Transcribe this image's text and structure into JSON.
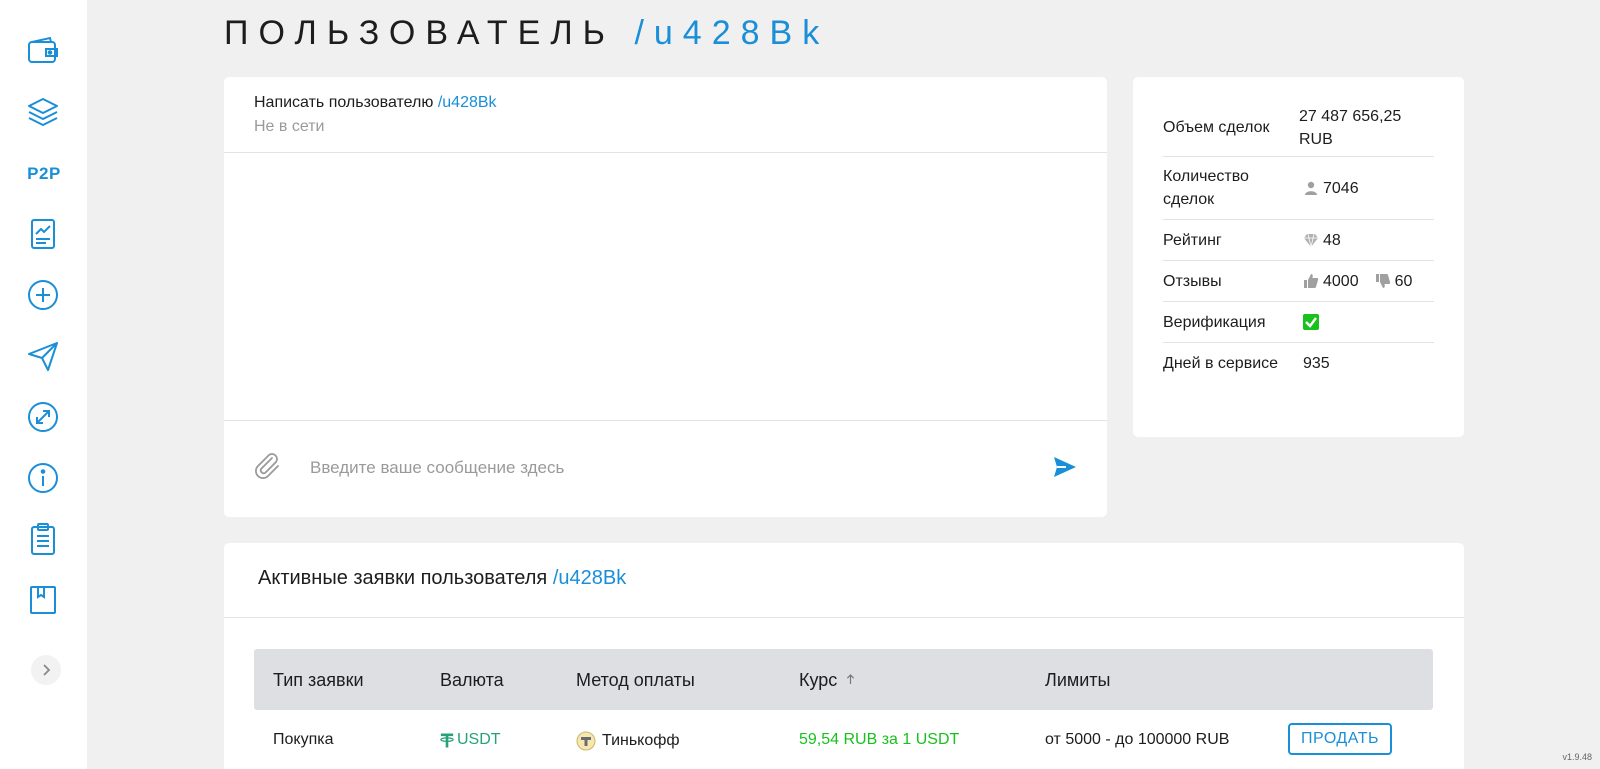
{
  "colors": {
    "accent": "#1a8fd8",
    "success": "#17c21d",
    "usdt": "#26a17b"
  },
  "sidebar": {
    "items": [
      {
        "name": "wallet-icon"
      },
      {
        "name": "layers-icon"
      },
      {
        "name": "p2p",
        "label": "P2P"
      },
      {
        "name": "report-chart-icon"
      },
      {
        "name": "plus-circle-icon"
      },
      {
        "name": "paper-plane-icon"
      },
      {
        "name": "exchange-circle-icon"
      },
      {
        "name": "info-circle-icon"
      },
      {
        "name": "clipboard-icon"
      },
      {
        "name": "book-icon"
      }
    ],
    "collapse_icon": "chevron-right-icon"
  },
  "title": {
    "prefix": "ПОЛЬЗОВАТЕЛЬ",
    "user": "/u428Bk"
  },
  "chat": {
    "write_label": "Написать пользователю",
    "user": "/u428Bk",
    "status": "Не в сети",
    "input_placeholder": "Введите ваше сообщение здесь",
    "input_value": ""
  },
  "stats": {
    "volume_label": "Объем сделок",
    "volume_value": "27 487 656,25 RUB",
    "deals_label": "Количество сделок",
    "deals_value": "7046",
    "rating_label": "Рейтинг",
    "rating_value": "48",
    "reviews_label": "Отзывы",
    "reviews_positive": "4000",
    "reviews_negative": "60",
    "verification_label": "Верификация",
    "verified": true,
    "days_label": "Дней в сервисе",
    "days_value": "935"
  },
  "orders": {
    "header_label": "Активные заявки пользователя",
    "user": "/u428Bk",
    "columns": [
      "Тип заявки",
      "Валюта",
      "Метод оплаты",
      "Курс",
      "Лимиты"
    ],
    "sort_icon": "arrow-up-icon",
    "rows": [
      {
        "type": "Покупка",
        "currency": "USDT",
        "payment": "Тинькофф",
        "rate": "59,54 RUB за 1 USDT",
        "limits": "от 5000 - до 100000 RUB",
        "action": "ПРОДАТЬ"
      }
    ]
  },
  "version": "v1.9.48"
}
